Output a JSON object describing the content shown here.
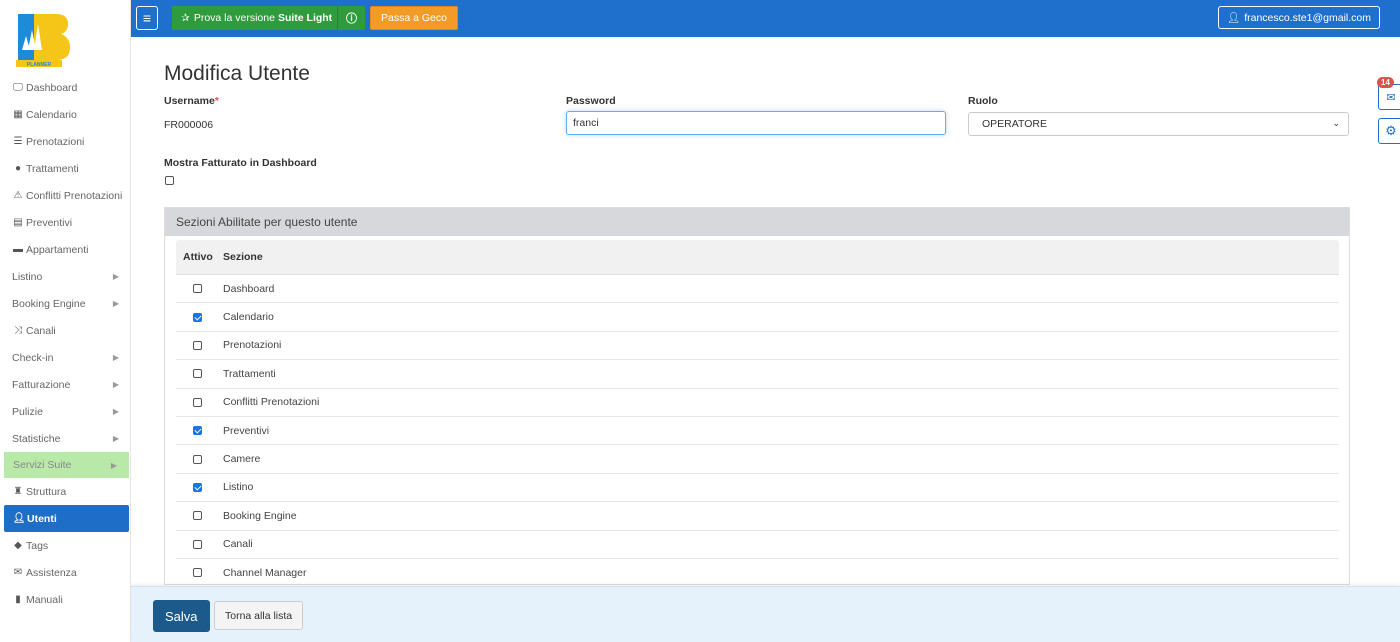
{
  "brand": {
    "logo_text": "PLANNER"
  },
  "topbar": {
    "trial_label": "Prova la versione",
    "trial_bold": "Suite Light",
    "geco_label": "Passa a Geco",
    "user_email": "francesco.ste1@gmail.com"
  },
  "sidebar": {
    "items": [
      {
        "label": "Dashboard",
        "icon": "monitor-icon"
      },
      {
        "label": "Calendario",
        "icon": "calendar-icon"
      },
      {
        "label": "Prenotazioni",
        "icon": "list-icon"
      },
      {
        "label": "Trattamenti",
        "icon": "apple-icon"
      },
      {
        "label": "Conflitti Prenotazioni",
        "icon": "warning-icon"
      },
      {
        "label": "Preventivi",
        "icon": "calculator-icon"
      },
      {
        "label": "Appartamenti",
        "icon": "bed-icon"
      },
      {
        "label": "Listino"
      },
      {
        "label": "Booking Engine"
      },
      {
        "label": "Canali",
        "icon": "shuffle-icon"
      },
      {
        "label": "Check-in"
      },
      {
        "label": "Fatturazione"
      },
      {
        "label": "Pulizie"
      },
      {
        "label": "Statistiche"
      },
      {
        "label": "Servizi Suite"
      },
      {
        "label": "Struttura",
        "icon": "tower-icon"
      },
      {
        "label": "Utenti",
        "icon": "user-icon"
      },
      {
        "label": "Tags",
        "icon": "tags-icon"
      },
      {
        "label": "Assistenza",
        "icon": "envelope-icon"
      },
      {
        "label": "Manuali",
        "icon": "book-icon"
      }
    ]
  },
  "form": {
    "title": "Modifica Utente",
    "username_label": "Username",
    "username_required": "*",
    "username_value": "FR000006",
    "password_label": "Password",
    "password_value": "franci",
    "role_label": "Ruolo",
    "role_value": "OPERATORE",
    "show_revenue_label": "Mostra Fatturato in Dashboard",
    "show_revenue_checked": false
  },
  "sections": {
    "panel_title": "Sezioni Abilitate per questo utente",
    "col_active": "Attivo",
    "col_section": "Sezione",
    "rows": [
      {
        "name": "Dashboard",
        "active": false
      },
      {
        "name": "Calendario",
        "active": true
      },
      {
        "name": "Prenotazioni",
        "active": false
      },
      {
        "name": "Trattamenti",
        "active": false
      },
      {
        "name": "Conflitti Prenotazioni",
        "active": false
      },
      {
        "name": "Preventivi",
        "active": true
      },
      {
        "name": "Camere",
        "active": false
      },
      {
        "name": "Listino",
        "active": true
      },
      {
        "name": "Booking Engine",
        "active": false
      },
      {
        "name": "Canali",
        "active": false
      },
      {
        "name": "Channel Manager",
        "active": false
      }
    ]
  },
  "floating": {
    "mail_badge": "14"
  },
  "footer": {
    "save_label": "Salva",
    "back_label": "Torna alla lista"
  },
  "colors": {
    "primary": "#1f6fcd",
    "green": "#2e9c3c",
    "orange": "#f29c27",
    "active_nav": "#1e6ec8",
    "suite_bg": "#b8e9a8"
  }
}
